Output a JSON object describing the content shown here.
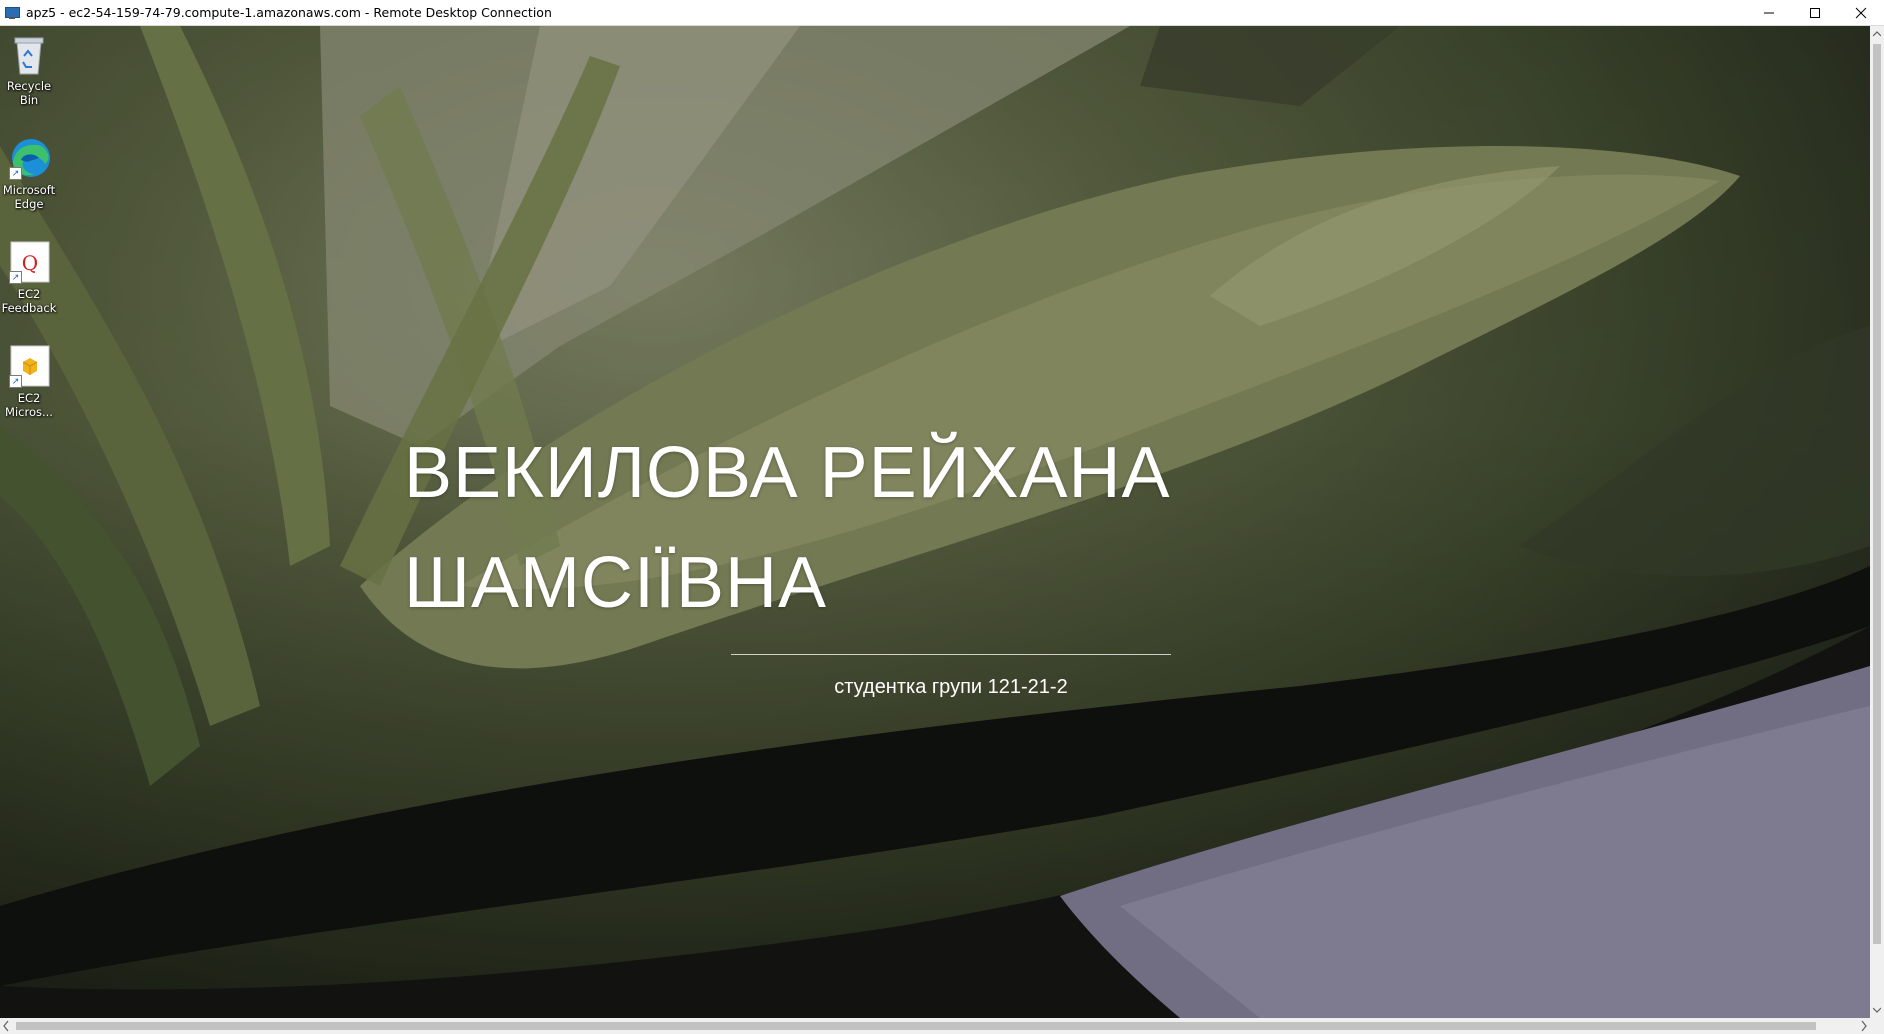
{
  "window": {
    "title": "apz5 - ec2-54-159-74-79.compute-1.amazonaws.com - Remote Desktop Connection",
    "controls": [
      "minimize-icon",
      "maximize-icon",
      "close-icon"
    ]
  },
  "desktop": {
    "icons": [
      {
        "label": "Recycle Bin",
        "icon": "recycle-bin-icon"
      },
      {
        "label": "Microsoft Edge",
        "icon": "edge-icon"
      },
      {
        "label": "EC2 Feedback",
        "icon": "ec2-feedback-icon"
      },
      {
        "label": "EC2 Micros...",
        "icon": "ec2-microsoft-icon"
      }
    ]
  },
  "hero": {
    "name_line1": "ВЕКИЛОВА РЕЙХАНА",
    "name_line2": "ШАМСІЇВНА",
    "subtitle": "студентка групи 121-21-2"
  },
  "colors": {
    "titlebar_bg": "#ffffff",
    "hero_text": "#ffffff",
    "scrollbar_bg": "#f0f0f0"
  }
}
